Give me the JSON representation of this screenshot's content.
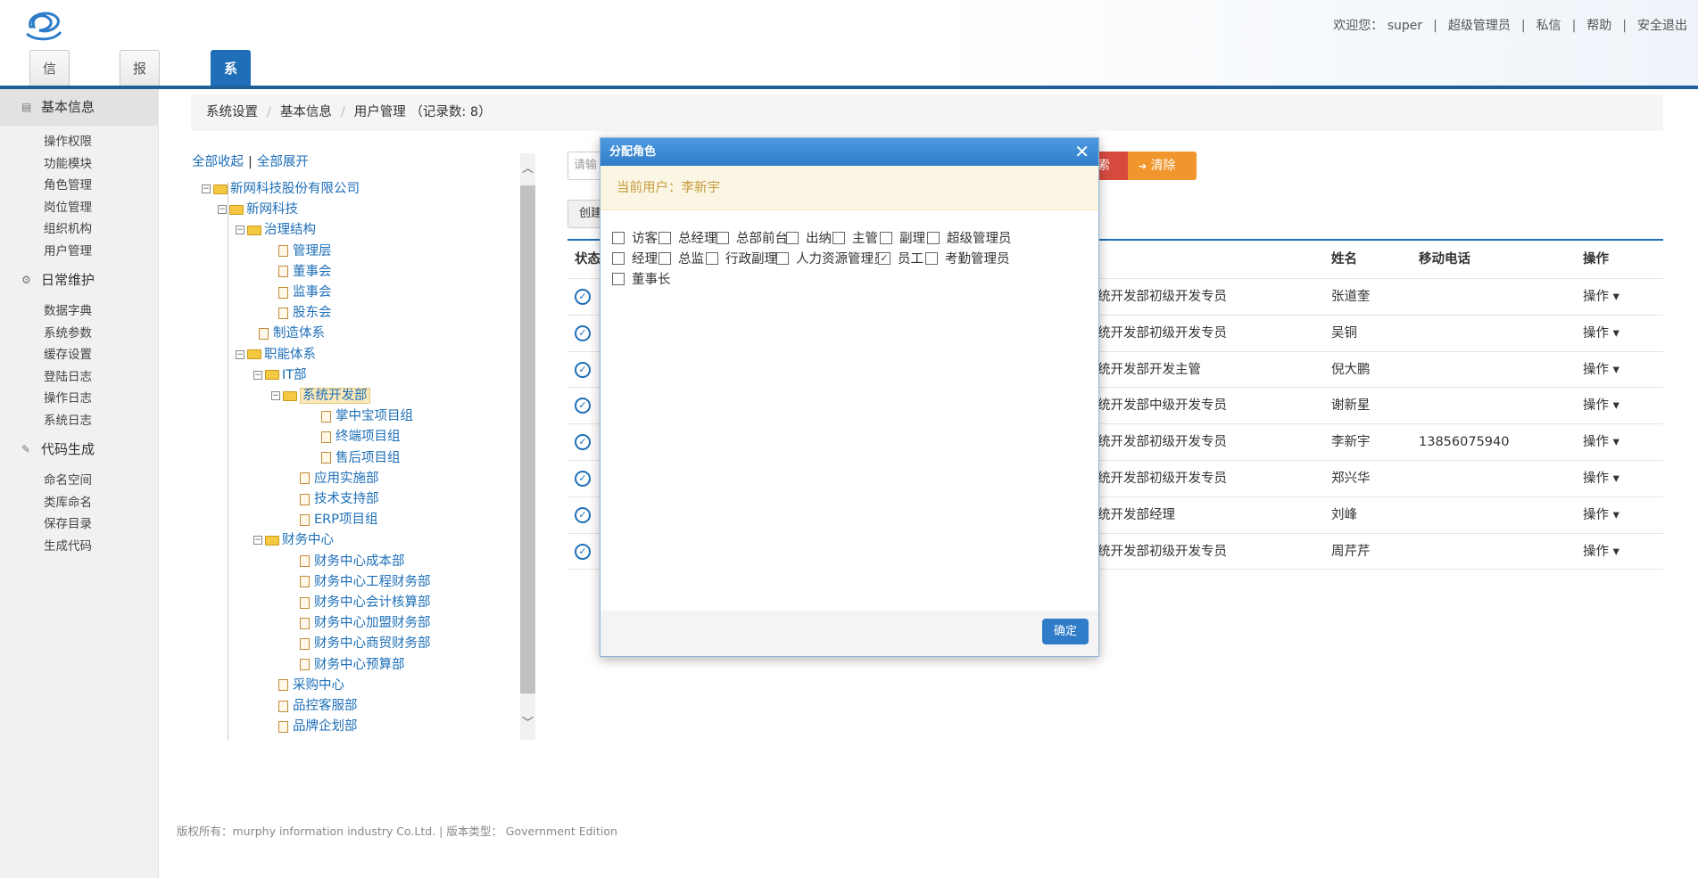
{
  "header": {
    "welcome": "欢迎您：",
    "user": "super",
    "role": "超级管理员",
    "messages": "私信",
    "help": "帮助",
    "logout": "安全退出",
    "sep": "|"
  },
  "tabs": [
    "信息中心",
    "报表中心",
    "系统设置"
  ],
  "sidebar": {
    "groups": [
      {
        "title": "基本信息",
        "items": [
          "操作权限",
          "功能模块",
          "角色管理",
          "岗位管理",
          "组织机构",
          "用户管理"
        ]
      },
      {
        "title": "日常维护",
        "items": [
          "数据字典",
          "系统参数",
          "缓存设置",
          "登陆日志",
          "操作日志",
          "系统日志"
        ]
      },
      {
        "title": "代码生成",
        "items": [
          "命名空间",
          "类库命名",
          "保存目录",
          "生成代码"
        ]
      }
    ]
  },
  "breadcrumb": {
    "items": [
      "系统设置",
      "基本信息",
      "用户管理 （记录数: 8）"
    ],
    "sep": "/"
  },
  "tree": {
    "collapse_all": "全部收起",
    "expand_all": "全部展开",
    "bar": "|",
    "nodes": [
      "新网科技股份有限公司",
      "新网科技",
      "治理结构",
      "管理层",
      "董事会",
      "监事会",
      "股东会",
      "制造体系",
      "职能体系",
      "IT部",
      "系统开发部",
      "掌中宝项目组",
      "终端项目组",
      "售后项目组",
      "应用实施部",
      "技术支持部",
      "ERP项目组",
      "财务中心",
      "财务中心成本部",
      "财务中心工程财务部",
      "财务中心会计核算部",
      "财务中心加盟财务部",
      "财务中心商贸财务部",
      "财务中心预算部",
      "采购中心",
      "品控客服部",
      "品牌企划部"
    ]
  },
  "toolbar": {
    "search_placeholder": "请输",
    "search_label": "索",
    "clear_label": "清除",
    "create_label": "创建"
  },
  "table": {
    "headers": {
      "status": "状态",
      "dept": "",
      "name": "姓名",
      "phone": "移动电话",
      "op": "操作"
    },
    "rows": [
      {
        "dept": "统开发部初级开发专员",
        "name": "张道奎",
        "phone": "",
        "op": "操作 ▾"
      },
      {
        "dept": "统开发部初级开发专员",
        "name": "吴铜",
        "phone": "",
        "op": "操作 ▾"
      },
      {
        "dept": "统开发部开发主管",
        "name": "倪大鹏",
        "phone": "",
        "op": "操作 ▾"
      },
      {
        "dept": "统开发部中级开发专员",
        "name": "谢新星",
        "phone": "",
        "op": "操作 ▾"
      },
      {
        "dept": "统开发部初级开发专员",
        "name": "李新宇",
        "phone": "13856075940",
        "op": "操作 ▾"
      },
      {
        "dept": "统开发部初级开发专员",
        "name": "郑兴华",
        "phone": "",
        "op": "操作 ▾"
      },
      {
        "dept": "统开发部经理",
        "name": "刘峰",
        "phone": "",
        "op": "操作 ▾"
      },
      {
        "dept": "统开发部初级开发专员",
        "name": "周芹芹",
        "phone": "",
        "op": "操作 ▾"
      }
    ]
  },
  "footer": "版权所有：murphy information industry Co.Ltd. | 版本类型： Government Edition",
  "dialog": {
    "title": "分配角色",
    "current_user": "当前用户：李新宇",
    "ok": "确定",
    "roles": [
      {
        "label": "访客",
        "checked": false
      },
      {
        "label": "总经理",
        "checked": false
      },
      {
        "label": "总部前台",
        "checked": false
      },
      {
        "label": "出纳",
        "checked": false
      },
      {
        "label": "主管",
        "checked": false
      },
      {
        "label": "副理",
        "checked": false
      },
      {
        "label": "超级管理员",
        "checked": false
      },
      {
        "label": "经理",
        "checked": false
      },
      {
        "label": "总监",
        "checked": false
      },
      {
        "label": "行政副理",
        "checked": false
      },
      {
        "label": "人力资源管理员",
        "checked": false
      },
      {
        "label": "员工",
        "checked": true
      },
      {
        "label": "考勤管理员",
        "checked": false
      },
      {
        "label": "董事长",
        "checked": false
      }
    ]
  },
  "colors": {
    "primary": "#1e6fb8",
    "search": "#d74b3f",
    "clear": "#f0962c"
  }
}
